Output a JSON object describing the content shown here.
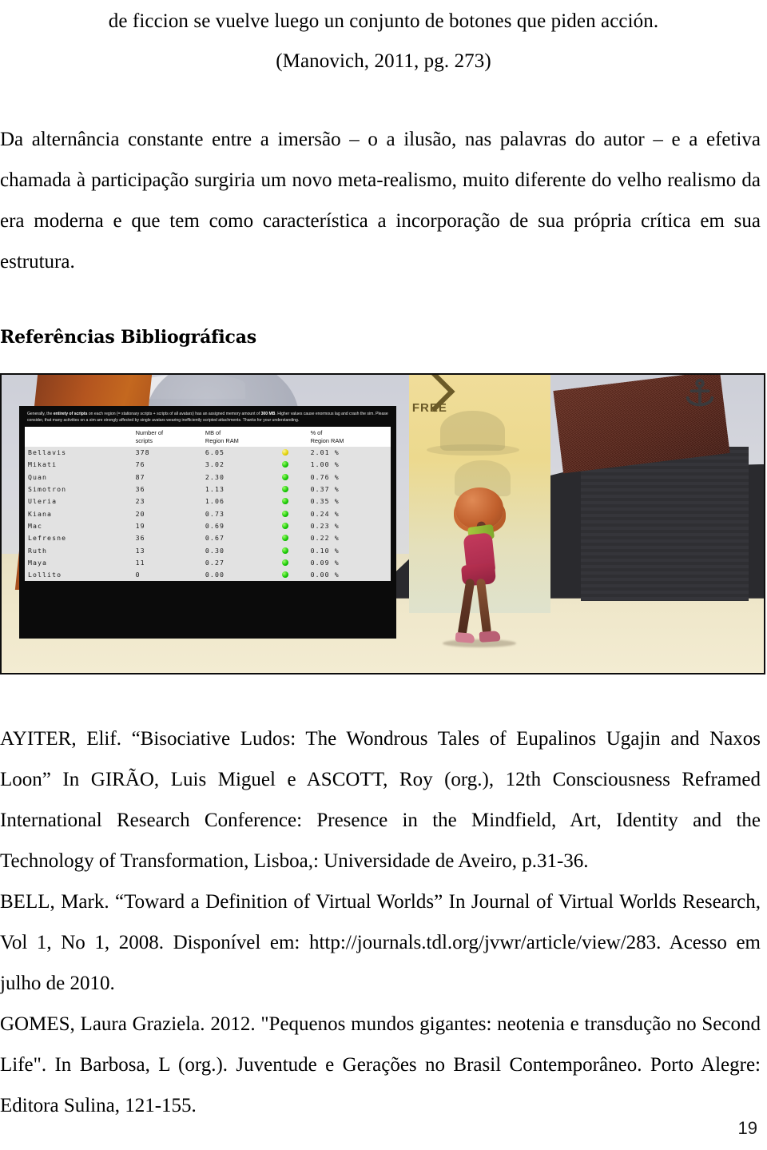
{
  "quote": {
    "line1": "de ficcion se vuelve luego un conjunto de botones que piden acción.",
    "citation": "(Manovich, 2011, pg. 273)"
  },
  "body": {
    "paragraph": "Da alternância constante entre a imersão – o a ilusão, nas palavras do autor – e a efetiva chamada à participação surgiria um novo meta-realismo, muito diferente do velho realismo da era moderna e que tem como característica a incorporação de sua própria crítica em sua estrutura."
  },
  "section": {
    "references_title": "Referências Bibliográficas"
  },
  "figure": {
    "sign_label": "FREE",
    "hud": {
      "note_prefix": "Generally, the ",
      "note_bold1": "entirety of scripts",
      "note_mid1": " on each region (= stationary scripts + scripts of all avatars) has an assigned memory amount of ",
      "note_bold2": "300 MB",
      "note_mid2": ". Higher values cause enormous lag and crash the sim. Please consider, that many activities on a sim are strongly affected by single avatars wearing inefficiently scripted attachments. Thanks for your understanding.",
      "columns": [
        "",
        "Number of\nscripts",
        "MB of\nRegion RAM",
        "",
        "% of\nRegion RAM"
      ],
      "rows": [
        {
          "name": "Bellavis",
          "scripts": "378",
          "mb": "6.05",
          "status": "yellow",
          "pct": "2.01",
          "pct_sign": "%"
        },
        {
          "name": "Mikati",
          "scripts": "76",
          "mb": "3.02",
          "status": "green",
          "pct": "1.00",
          "pct_sign": "%"
        },
        {
          "name": "Quan",
          "scripts": "87",
          "mb": "2.30",
          "status": "green",
          "pct": "0.76",
          "pct_sign": "%"
        },
        {
          "name": "Simotron",
          "scripts": "36",
          "mb": "1.13",
          "status": "green",
          "pct": "0.37",
          "pct_sign": "%"
        },
        {
          "name": "Uleria",
          "scripts": "23",
          "mb": "1.06",
          "status": "green",
          "pct": "0.35",
          "pct_sign": "%"
        },
        {
          "name": "Kiana",
          "scripts": "20",
          "mb": "0.73",
          "status": "green",
          "pct": "0.24",
          "pct_sign": "%"
        },
        {
          "name": "Mac",
          "scripts": "19",
          "mb": "0.69",
          "status": "green",
          "pct": "0.23",
          "pct_sign": "%"
        },
        {
          "name": "Lefresne",
          "scripts": "36",
          "mb": "0.67",
          "status": "green",
          "pct": "0.22",
          "pct_sign": "%"
        },
        {
          "name": "Ruth",
          "scripts": "13",
          "mb": "0.30",
          "status": "green",
          "pct": "0.10",
          "pct_sign": "%"
        },
        {
          "name": "Maya",
          "scripts": "11",
          "mb": "0.27",
          "status": "green",
          "pct": "0.09",
          "pct_sign": "%"
        },
        {
          "name": "Lollito",
          "scripts": "0",
          "mb": "0.00",
          "status": "green",
          "pct": "0.00",
          "pct_sign": "%"
        }
      ],
      "status_colors": {
        "green": "#12c400",
        "yellow": "#e0d000"
      }
    }
  },
  "references": [
    "AYITER, Elif. “Bisociative Ludos: The Wondrous Tales of Eupalinos Ugajin and Naxos Loon” In GIRÃO, Luis Miguel e ASCOTT, Roy (org.), 12th Consciousness Reframed International Research Conference: Presence in the Mindfield, Art, Identity and the Technology of Transformation, Lisboa,: Universidade de Aveiro, p.31-36.",
    "BELL, Mark. “Toward a Definition of Virtual Worlds” In Journal of Virtual Worlds Research, Vol 1, No 1, 2008. Disponível em: http://journals.tdl.org/jvwr/article/view/283. Acesso em julho de 2010.",
    "GOMES, Laura Graziela. 2012. \"Pequenos mundos gigantes: neotenia e transdução no Second Life\". In Barbosa, L (org.). Juventude e Gerações no Brasil Contemporâneo. Porto Alegre: Editora Sulina, 121-155."
  ],
  "footer": {
    "page_number": "19"
  }
}
